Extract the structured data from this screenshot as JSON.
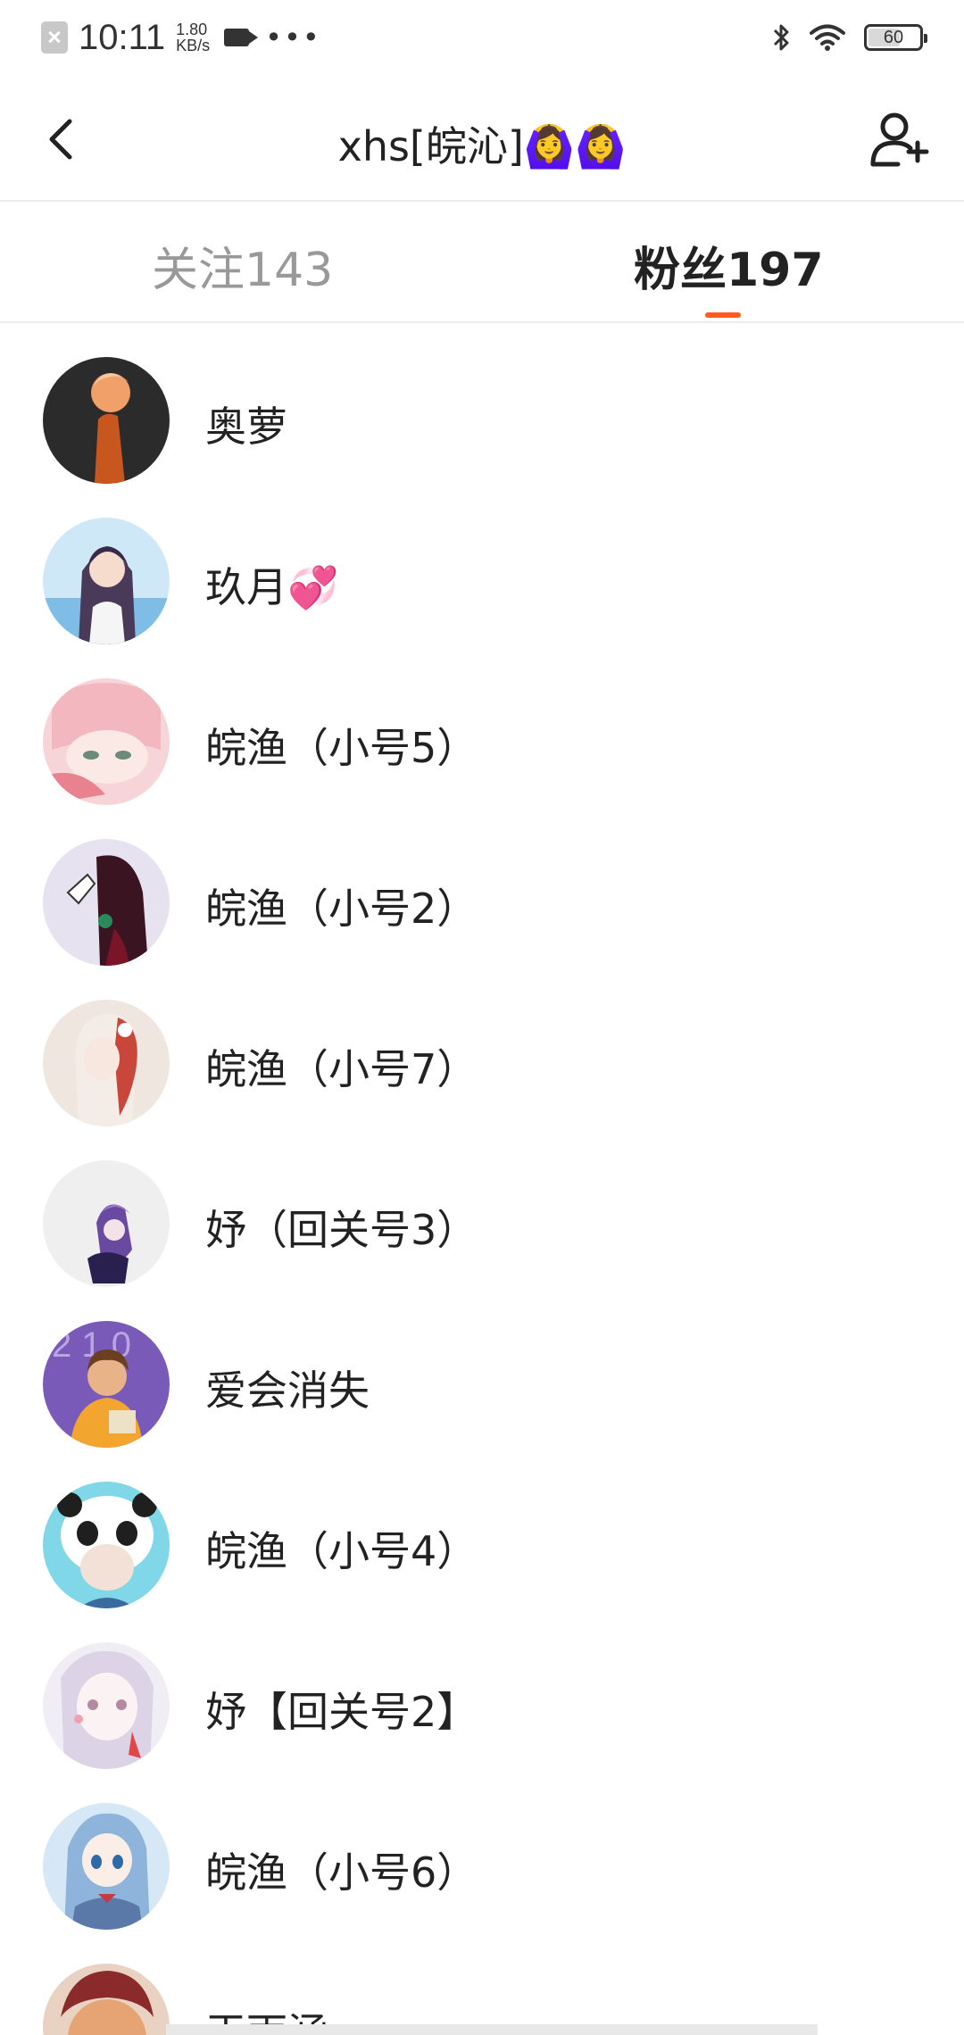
{
  "status_bar": {
    "time": "10:11",
    "net_speed_value": "1.80",
    "net_speed_unit": "KB/s",
    "more": "•••",
    "battery": "60"
  },
  "header": {
    "title": "xhs[皖沁]🙆‍♀️🙆‍♀️"
  },
  "tabs": [
    {
      "label": "关注143",
      "active": false
    },
    {
      "label": "粉丝197",
      "active": true
    }
  ],
  "accent_color": "#ff5a1f",
  "fans": [
    {
      "name": "奥萝",
      "avatar_colors": [
        "#2b2b2b",
        "#f2a06a"
      ]
    },
    {
      "name": "玖月💞",
      "avatar_colors": [
        "#bfe0f5",
        "#5a4a6a"
      ]
    },
    {
      "name": "皖渔（小号5）",
      "avatar_colors": [
        "#f7c9cf",
        "#e98a95"
      ]
    },
    {
      "name": "皖渔（小号2）",
      "avatar_colors": [
        "#e6e1ee",
        "#3a1a24"
      ]
    },
    {
      "name": "皖渔（小号7）",
      "avatar_colors": [
        "#efe4dc",
        "#c24a3c"
      ]
    },
    {
      "name": "妤（回关号3）",
      "avatar_colors": [
        "#efefef",
        "#5a3a8a"
      ]
    },
    {
      "name": "爱会消失",
      "avatar_colors": [
        "#7a5ab8",
        "#f0a830"
      ]
    },
    {
      "name": "皖渔（小号4）",
      "avatar_colors": [
        "#7fd7e8",
        "#2a2a2a"
      ]
    },
    {
      "name": "妤【回关号2】",
      "avatar_colors": [
        "#f0ecf3",
        "#d7d0e0"
      ]
    },
    {
      "name": "皖渔（小号6）",
      "avatar_colors": [
        "#bcd6ec",
        "#6a92c8"
      ]
    },
    {
      "name": "王雨涵",
      "avatar_colors": [
        "#8a2a2a",
        "#e0a070"
      ]
    }
  ]
}
